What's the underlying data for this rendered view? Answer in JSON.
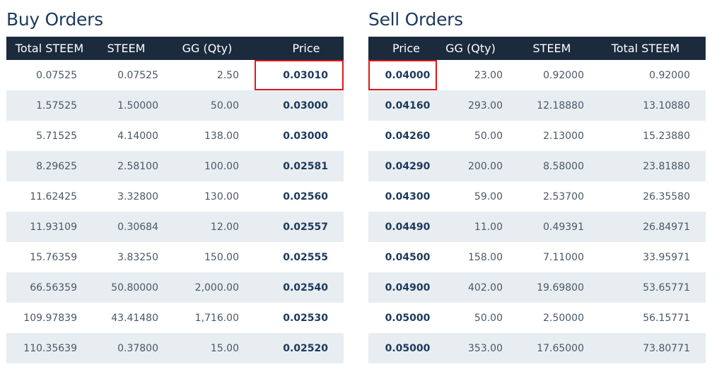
{
  "buy": {
    "title": "Buy Orders",
    "headers": [
      "Total STEEM",
      "STEEM",
      "GG (Qty)",
      "Price"
    ],
    "rows": [
      [
        "0.07525",
        "0.07525",
        "2.50",
        "0.03010"
      ],
      [
        "1.57525",
        "1.50000",
        "50.00",
        "0.03000"
      ],
      [
        "5.71525",
        "4.14000",
        "138.00",
        "0.03000"
      ],
      [
        "8.29625",
        "2.58100",
        "100.00",
        "0.02581"
      ],
      [
        "11.62425",
        "3.32800",
        "130.00",
        "0.02560"
      ],
      [
        "11.93109",
        "0.30684",
        "12.00",
        "0.02557"
      ],
      [
        "15.76359",
        "3.83250",
        "150.00",
        "0.02555"
      ],
      [
        "66.56359",
        "50.80000",
        "2,000.00",
        "0.02540"
      ],
      [
        "109.97839",
        "43.41480",
        "1,716.00",
        "0.02530"
      ],
      [
        "110.35639",
        "0.37800",
        "15.00",
        "0.02520"
      ]
    ]
  },
  "sell": {
    "title": "Sell Orders",
    "headers": [
      "Price",
      "GG (Qty)",
      "STEEM",
      "Total STEEM"
    ],
    "rows": [
      [
        "0.04000",
        "23.00",
        "0.92000",
        "0.92000"
      ],
      [
        "0.04160",
        "293.00",
        "12.18880",
        "13.10880"
      ],
      [
        "0.04260",
        "50.00",
        "2.13000",
        "15.23880"
      ],
      [
        "0.04290",
        "200.00",
        "8.58000",
        "23.81880"
      ],
      [
        "0.04300",
        "59.00",
        "2.53700",
        "26.35580"
      ],
      [
        "0.04490",
        "11.00",
        "0.49391",
        "26.84971"
      ],
      [
        "0.04500",
        "158.00",
        "7.11000",
        "33.95971"
      ],
      [
        "0.04900",
        "402.00",
        "19.69800",
        "53.65771"
      ],
      [
        "0.05000",
        "50.00",
        "2.50000",
        "56.15771"
      ],
      [
        "0.05000",
        "353.00",
        "17.65000",
        "73.80771"
      ]
    ]
  },
  "colors": {
    "header_bg": "#1b2b3d",
    "stripe_bg": "#e8edf1",
    "title_text": "#1d3a5c",
    "highlight_box": "#e01818"
  }
}
